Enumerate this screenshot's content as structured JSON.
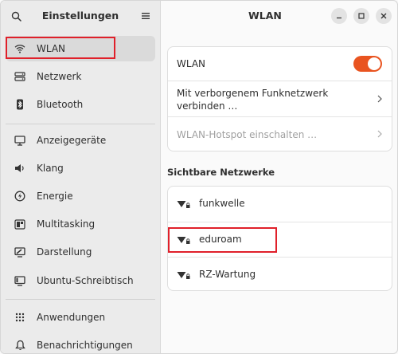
{
  "sidebar": {
    "title": "Einstellungen",
    "items": [
      {
        "label": "WLAN",
        "icon": "wifi-icon"
      },
      {
        "label": "Netzwerk",
        "icon": "network-icon"
      },
      {
        "label": "Bluetooth",
        "icon": "bluetooth-icon"
      },
      {
        "label": "Anzeigegeräte",
        "icon": "display-icon"
      },
      {
        "label": "Klang",
        "icon": "speaker-icon"
      },
      {
        "label": "Energie",
        "icon": "power-icon"
      },
      {
        "label": "Multitasking",
        "icon": "multitasking-icon"
      },
      {
        "label": "Darstellung",
        "icon": "appearance-icon"
      },
      {
        "label": "Ubuntu-Schreibtisch",
        "icon": "ubuntu-desktop-icon"
      },
      {
        "label": "Anwendungen",
        "icon": "apps-grid-icon"
      },
      {
        "label": "Benachrichtigungen",
        "icon": "bell-icon"
      }
    ]
  },
  "main": {
    "title": "WLAN",
    "settings": {
      "wlan_label": "WLAN",
      "wlan_enabled": true,
      "hidden_network_label": "Mit verborgenem Funknetzwerk verbinden …",
      "hotspot_label": "WLAN-Hotspot einschalten …"
    },
    "networks_title": "Sichtbare Netzwerke",
    "networks": [
      {
        "name": "funkwelle",
        "secured": true
      },
      {
        "name": "eduroam",
        "secured": true
      },
      {
        "name": "RZ-Wartung",
        "secured": true
      }
    ]
  },
  "colors": {
    "accent": "#e95420",
    "highlight": "#e0202a"
  }
}
